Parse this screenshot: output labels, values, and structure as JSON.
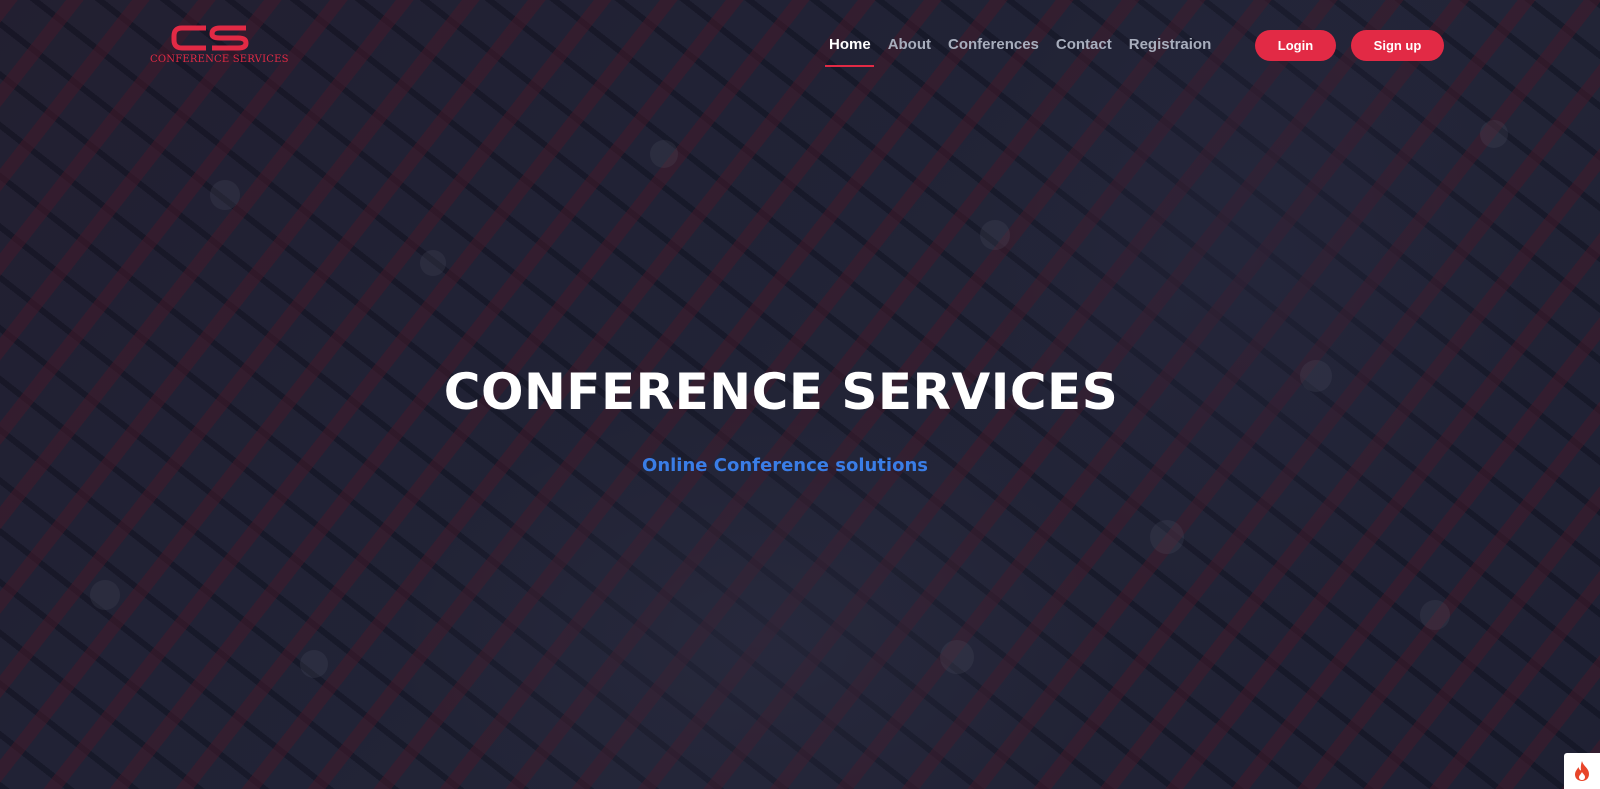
{
  "brand": {
    "logo_text": "CONFERENCE SERVICES",
    "accent_color": "#e22a45"
  },
  "nav": {
    "items": [
      {
        "label": "Home",
        "active": true
      },
      {
        "label": "About",
        "active": false
      },
      {
        "label": "Conferences",
        "active": false
      },
      {
        "label": "Contact",
        "active": false
      },
      {
        "label": "Registraion",
        "active": false
      }
    ]
  },
  "auth": {
    "login_label": "Login",
    "signup_label": "Sign up"
  },
  "hero": {
    "title": "CONFERENCE SERVICES",
    "subtitle": "Online Conference solutions",
    "subtitle_color": "#3a7de6"
  },
  "corner_badge": {
    "icon": "flame-icon"
  }
}
